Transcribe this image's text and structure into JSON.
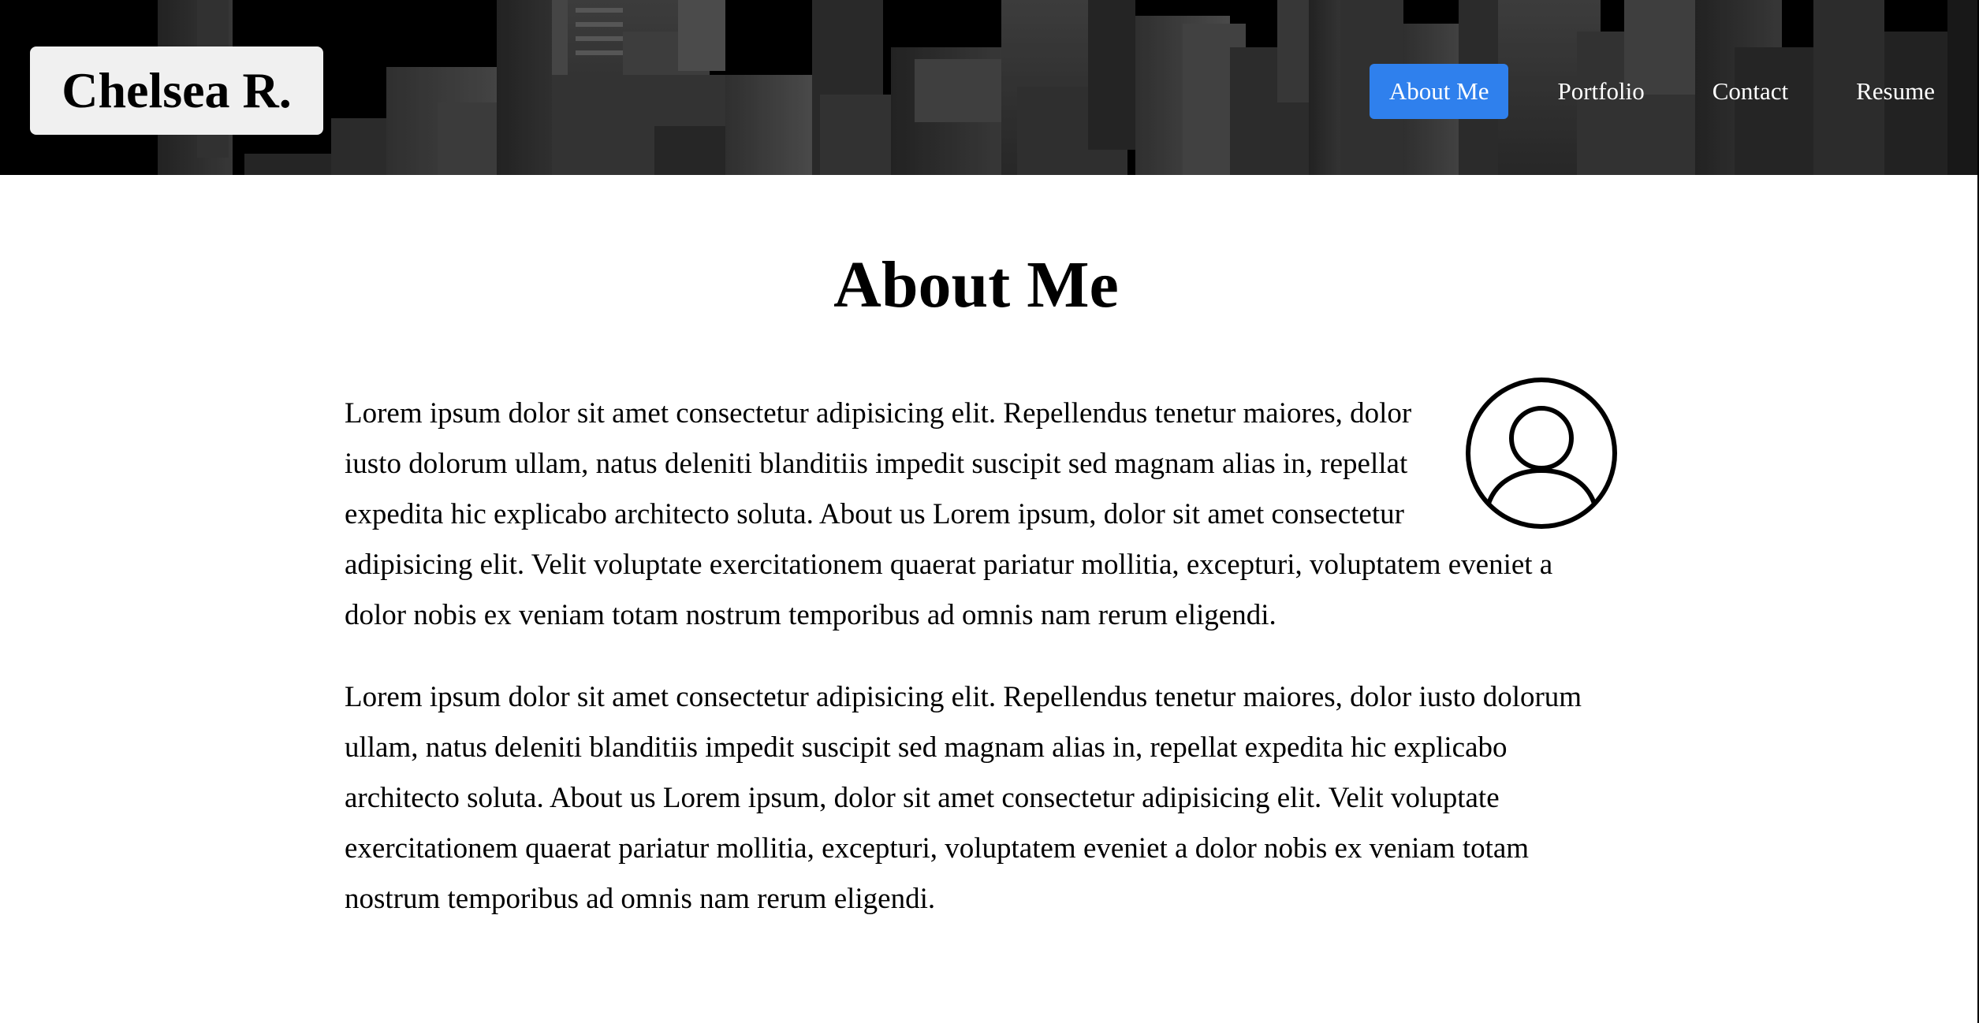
{
  "header": {
    "brand": "Chelsea R.",
    "nav": [
      {
        "label": "About Me",
        "active": true
      },
      {
        "label": "Portfolio",
        "active": false
      },
      {
        "label": "Contact",
        "active": false
      },
      {
        "label": "Resume",
        "active": false
      }
    ]
  },
  "main": {
    "title": "About Me",
    "paragraphs": [
      "Lorem ipsum dolor sit amet consectetur adipisicing elit. Repellendus tenetur maiores, dolor iusto dolorum ullam, natus deleniti blanditiis impedit suscipit sed magnam alias in, repellat expedita hic explicabo architecto soluta. About us Lorem ipsum, dolor sit amet consectetur adipisicing elit. Velit voluptate exercitationem quaerat pariatur mollitia, excepturi, voluptatem eveniet a dolor nobis ex veniam totam nostrum temporibus ad omnis nam rerum eligendi.",
      "Lorem ipsum dolor sit amet consectetur adipisicing elit. Repellendus tenetur maiores, dolor iusto dolorum ullam, natus deleniti blanditiis impedit suscipit sed magnam alias in, repellat expedita hic explicabo architecto soluta. About us Lorem ipsum, dolor sit amet consectetur adipisicing elit. Velit voluptate exercitationem quaerat pariatur mollitia, excepturi, voluptatem eveniet a dolor nobis ex veniam totam nostrum temporibus ad omnis nam rerum eligendi."
    ],
    "avatar_icon": "user-circle-icon"
  },
  "colors": {
    "header_bg": "#000000",
    "brand_bg": "#f0f0f0",
    "nav_active_bg": "#2f80ed",
    "nav_text": "#ffffff",
    "page_bg": "#ffffff",
    "text": "#000000"
  }
}
